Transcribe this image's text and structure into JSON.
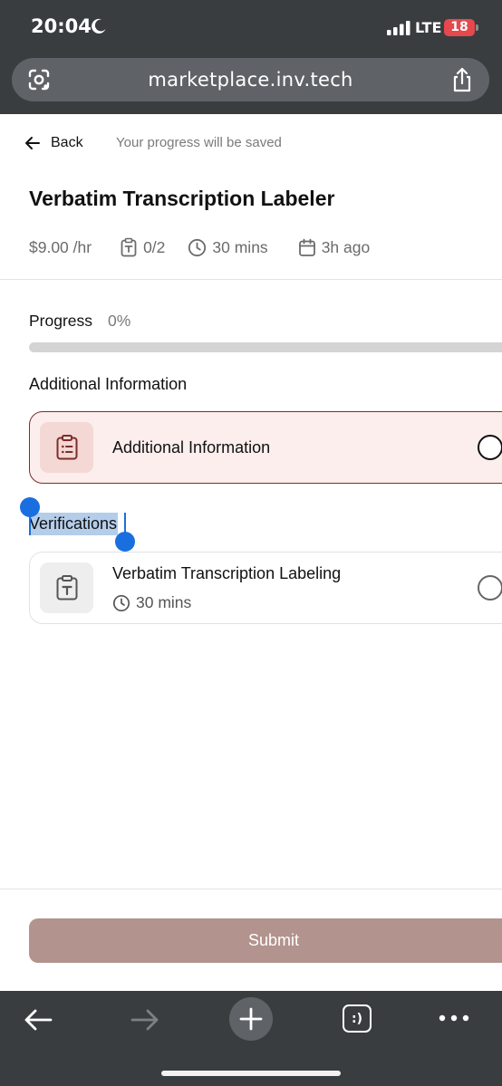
{
  "status_bar": {
    "time": "20:04",
    "network": "LTE",
    "battery": "18"
  },
  "browser": {
    "url": "marketplace.inv.tech",
    "tabs_label": ":)"
  },
  "header": {
    "back_label": "Back",
    "saved_note": "Your progress will be saved",
    "title": "Verbatim Transcription Labeler",
    "meta": {
      "rate": "$9.00 /hr",
      "tasks": "0/2",
      "duration": "30 mins",
      "posted": "3h ago"
    }
  },
  "progress": {
    "label": "Progress",
    "value_text": "0%",
    "fraction": 0
  },
  "sections": {
    "additional_heading": "Additional Information",
    "verifications_heading": "Verifications"
  },
  "cards": {
    "additional": {
      "title": "Additional Information",
      "icon": "clipboard-list-icon"
    },
    "verification": {
      "title": "Verbatim Transcription Labeling",
      "duration": "30 mins",
      "icon": "clipboard-text-icon"
    }
  },
  "actions": {
    "submit_label": "Submit"
  },
  "colors": {
    "accent": "#7a2e2a",
    "accent_bg": "#fbeeec",
    "submit_bg": "#b3938d",
    "selection": "#b4cdea",
    "chrome": "#3a3d40"
  }
}
